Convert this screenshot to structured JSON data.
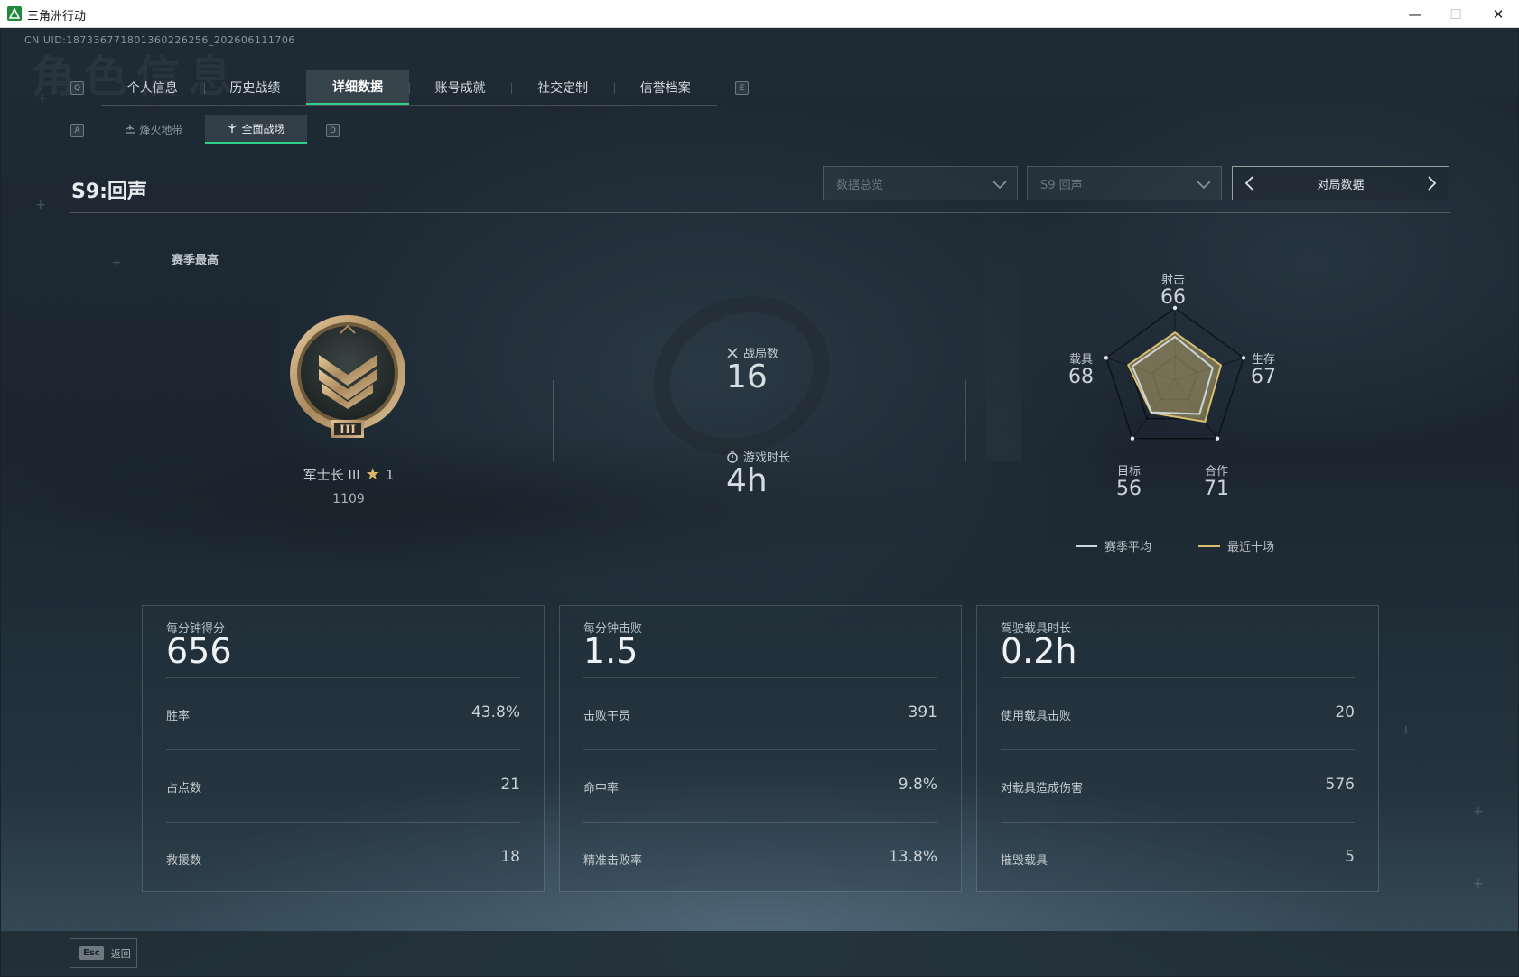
{
  "window": {
    "title": "三角洲行动",
    "min": "—",
    "max": "☐",
    "close": "✕"
  },
  "uid": "CN UID:18733677180136022625​6_202606111706",
  "ghost_title": "角色信息",
  "main_tabs": {
    "left_key": "Q",
    "right_key": "E",
    "items": [
      {
        "label": "个人信息"
      },
      {
        "label": "历史战绩"
      },
      {
        "label": "详细数据"
      },
      {
        "label": "账号成就"
      },
      {
        "label": "社交定制"
      },
      {
        "label": "信誉档案"
      }
    ]
  },
  "sub_tabs": {
    "left_key": "A",
    "right_key": "D",
    "items": [
      {
        "label": "烽火地带",
        "icon": "flame-zone-icon"
      },
      {
        "label": "全面战场",
        "icon": "battlefield-icon"
      }
    ]
  },
  "season_title": "S9:回声",
  "filters": {
    "overview": "数据总览",
    "season": "S9 回声",
    "match_data": "对局数据"
  },
  "rank": {
    "season_best_label": "赛季最高",
    "badge_numeral": "III",
    "name": "军士长 III",
    "stars": "1",
    "points": "1109"
  },
  "summary": {
    "matches_label": "战局数",
    "matches_value": "16",
    "playtime_label": "游戏时长",
    "playtime_value": "4h"
  },
  "radar": {
    "axes": [
      {
        "label": "射击",
        "value": "66"
      },
      {
        "label": "生存",
        "value": "67"
      },
      {
        "label": "合作",
        "value": "71"
      },
      {
        "label": "目标",
        "value": "56"
      },
      {
        "label": "载具",
        "value": "68"
      }
    ],
    "season_avg": [
      0.6,
      0.55,
      0.58,
      0.55,
      0.62
    ],
    "recent_ten": [
      0.66,
      0.67,
      0.71,
      0.56,
      0.68
    ],
    "legend_avg": "赛季平均",
    "legend_recent": "最近十场",
    "color_avg": "#cfd5d8",
    "color_recent": "#d8c070"
  },
  "cards": [
    {
      "head_label": "每分钟得分",
      "head_value": "656",
      "rows": [
        {
          "label": "胜率",
          "value": "43.8%"
        },
        {
          "label": "占点数",
          "value": "21"
        },
        {
          "label": "救援数",
          "value": "18"
        }
      ]
    },
    {
      "head_label": "每分钟击败",
      "head_value": "1.5",
      "rows": [
        {
          "label": "击败干员",
          "value": "391"
        },
        {
          "label": "命中率",
          "value": "9.8%"
        },
        {
          "label": "精准击败率",
          "value": "13.8%"
        }
      ]
    },
    {
      "head_label": "驾驶载具时长",
      "head_value": "0.2h",
      "rows": [
        {
          "label": "使用载具击败",
          "value": "20"
        },
        {
          "label": "对载具造成伤害",
          "value": "576"
        },
        {
          "label": "摧毁载具",
          "value": "5"
        }
      ]
    }
  ],
  "bottom": {
    "esc_key": "Esc",
    "back_label": "返回"
  },
  "accent_color": "#2fd08a"
}
